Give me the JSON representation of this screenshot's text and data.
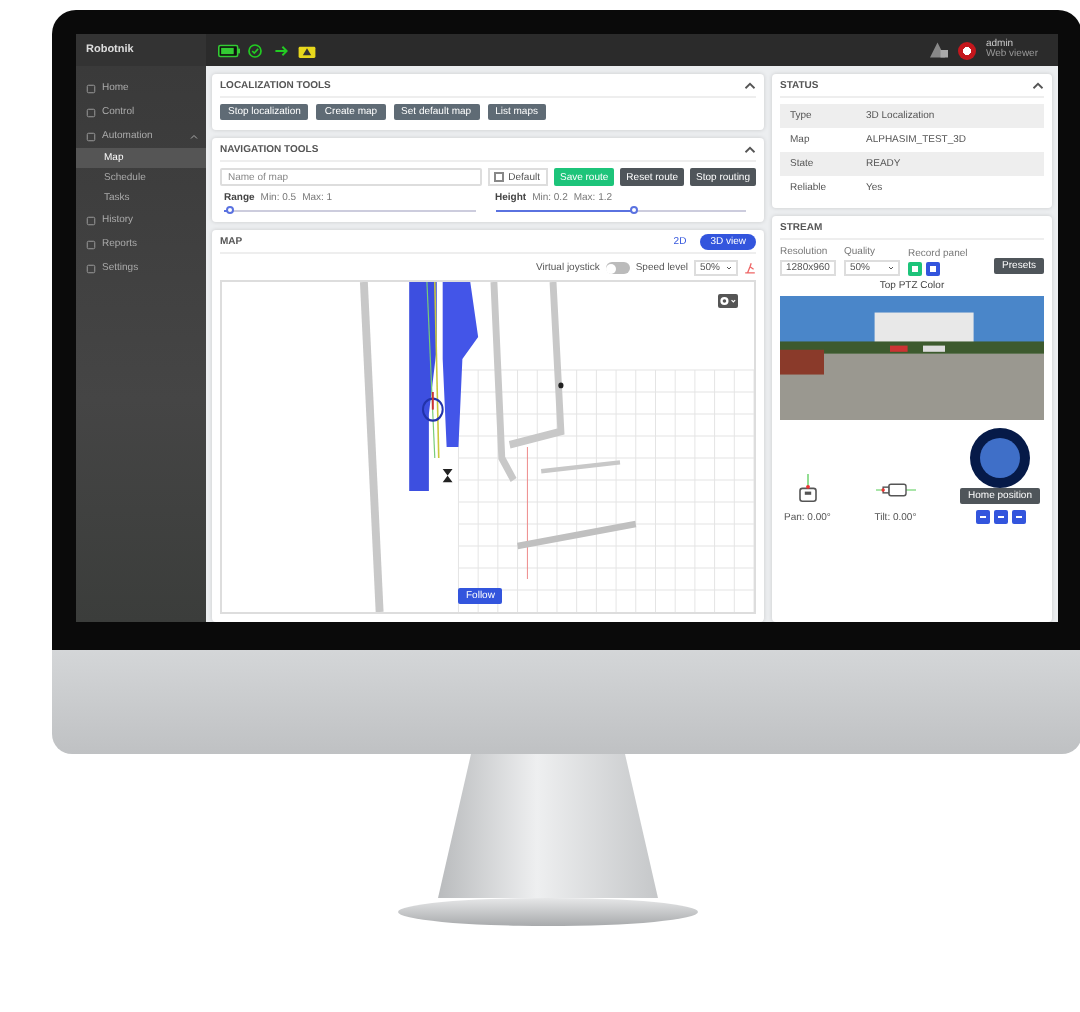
{
  "topbar": {
    "logo": "Robotnik",
    "user": "admin",
    "role": "Web viewer"
  },
  "sidebar": {
    "items": [
      {
        "label": "Home",
        "selected": false
      },
      {
        "label": "Control",
        "selected": false
      },
      {
        "label": "Automation",
        "selected": false,
        "expanded": true,
        "children": [
          {
            "label": "Map",
            "selected": true
          },
          {
            "label": "Schedule",
            "selected": false
          },
          {
            "label": "Tasks",
            "selected": false
          }
        ]
      },
      {
        "label": "History",
        "selected": false
      },
      {
        "label": "Reports",
        "selected": false
      },
      {
        "label": "Settings",
        "selected": false
      }
    ]
  },
  "localization": {
    "title": "LOCALIZATION TOOLS",
    "buttons": [
      "Stop localization",
      "Create map",
      "Set default map",
      "List maps"
    ]
  },
  "navigation": {
    "title": "NAVIGATION TOOLS",
    "map_name": {
      "placeholder": "Name of map"
    },
    "default": {
      "label": "Default",
      "checked": false
    },
    "buttons": [
      {
        "label": "Save route",
        "kind": "primary"
      },
      {
        "label": "Reset route",
        "kind": "dark"
      },
      {
        "label": "Stop routing",
        "kind": "dark"
      }
    ],
    "sliders": [
      {
        "label": "Range",
        "min": "Min: 0.5",
        "max": "Max: 1",
        "level": 0.02
      },
      {
        "label": "Height",
        "min": "Min: 0.2",
        "max": "Max: 1.2",
        "level": 0.55
      }
    ]
  },
  "map": {
    "title": "MAP",
    "views": [
      {
        "label": "2D",
        "selected": false
      },
      {
        "label": "3D view",
        "selected": true
      }
    ],
    "joystick": {
      "label": "Virtual joystick",
      "on": false
    },
    "speed": {
      "label": "Speed level",
      "value": "50%"
    },
    "follow": "Follow"
  },
  "status": {
    "title": "STATUS",
    "rows": [
      {
        "label": "Type",
        "value": "3D Localization"
      },
      {
        "label": "Map",
        "value": "ALPHASIM_TEST_3D"
      },
      {
        "label": "State",
        "value": "READY"
      },
      {
        "label": "Reliable",
        "value": "Yes"
      }
    ]
  },
  "stream": {
    "title": "STREAM",
    "resolution": {
      "label": "Resolution",
      "value": "1280x960"
    },
    "quality": {
      "label": "Quality",
      "value": "50%"
    },
    "record": "Record panel",
    "presets": "Presets",
    "camera": "Top PTZ Color",
    "pan": "Pan: 0.00°",
    "tilt": "Tilt: 0.00°",
    "home": "Home position"
  }
}
